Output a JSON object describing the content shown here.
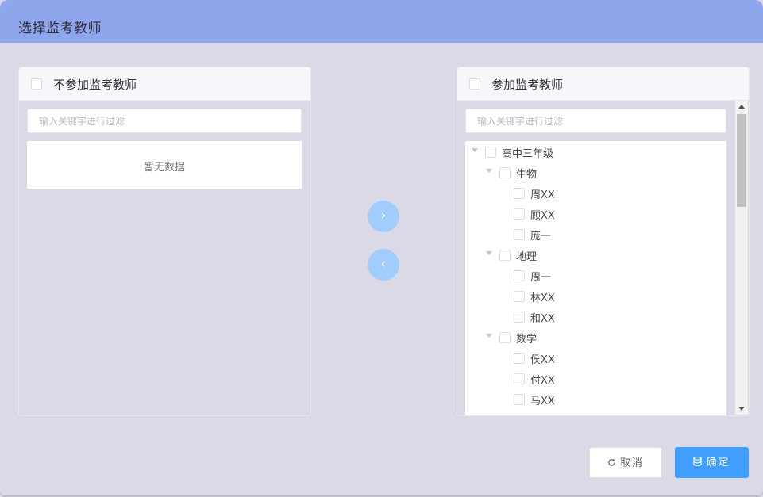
{
  "dialog": {
    "title": "选择监考教师"
  },
  "left_panel": {
    "title": "不参加监考教师",
    "filter_placeholder": "输入关键字进行过滤",
    "empty_text": "暂无数据"
  },
  "right_panel": {
    "title": "参加监考教师",
    "filter_placeholder": "输入关键字进行过滤",
    "tree": {
      "grade": "高中三年级",
      "subjects": [
        {
          "name": "生物",
          "teachers": [
            "周XX",
            "顾XX",
            "庞一"
          ]
        },
        {
          "name": "地理",
          "teachers": [
            "周一",
            "林XX",
            "和XX"
          ]
        },
        {
          "name": "数学",
          "teachers": [
            "侯XX",
            "付XX",
            "马XX"
          ]
        }
      ]
    }
  },
  "transfer": {
    "to_right_icon": "chevron-right-icon",
    "to_right_glyph": "›",
    "to_left_icon": "chevron-left-icon",
    "to_left_glyph": "‹"
  },
  "footer": {
    "cancel_label": "取消",
    "cancel_icon": "refresh-icon",
    "ok_label": "确定",
    "ok_icon": "database-icon"
  },
  "colors": {
    "header": "#8fa6ec",
    "primary": "#409eff",
    "transfer_button": "#a0cdfd",
    "background": "#dcd9e6"
  }
}
